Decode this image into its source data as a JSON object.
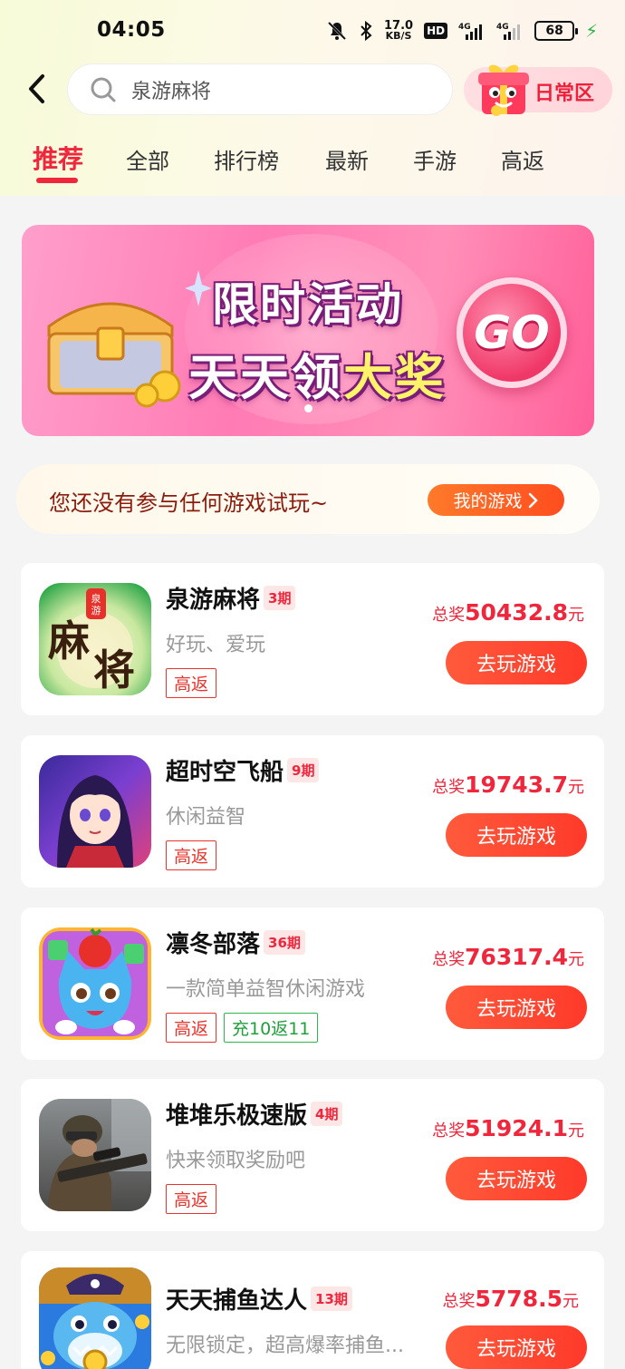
{
  "status_bar": {
    "time": "04:05",
    "net_speed_value": "17.0",
    "net_speed_unit": "KB/S",
    "hd_label": "HD",
    "signal1_label": "4G",
    "signal2_label": "4G",
    "battery": "68"
  },
  "header": {
    "search_value": "泉游麻将",
    "daily_zone_label": "日常区"
  },
  "tabs": [
    "推荐",
    "全部",
    "排行榜",
    "最新",
    "手游",
    "高返"
  ],
  "banner": {
    "line1": "限时活动",
    "line2_main": "天天领",
    "line2_highlight": "大奖",
    "go_label": "GO"
  },
  "notice": {
    "text": "您还没有参与任何游戏试玩~",
    "button_label": "我的游戏"
  },
  "games": [
    {
      "name": "泉游麻将",
      "period": "3期",
      "desc": "好玩、爱玩",
      "tags": [
        "高返"
      ],
      "prize_label": "总奖",
      "prize_value": "50432.8",
      "prize_unit": "元",
      "button": "去玩游戏",
      "icon_text_top": "泉游",
      "icon_text_main": "麻将"
    },
    {
      "name": "超时空飞船",
      "period": "9期",
      "desc": "休闲益智",
      "tags": [
        "高返"
      ],
      "prize_label": "总奖",
      "prize_value": "19743.7",
      "prize_unit": "元",
      "button": "去玩游戏"
    },
    {
      "name": "凛冬部落",
      "period": "36期",
      "desc": "一款简单益智休闲游戏",
      "tags": [
        "高返",
        "充10返11"
      ],
      "prize_label": "总奖",
      "prize_value": "76317.4",
      "prize_unit": "元",
      "button": "去玩游戏"
    },
    {
      "name": "堆堆乐极速版",
      "period": "4期",
      "desc": "快来领取奖励吧",
      "tags": [
        "高返"
      ],
      "prize_label": "总奖",
      "prize_value": "51924.1",
      "prize_unit": "元",
      "button": "去玩游戏"
    },
    {
      "name": "天天捕鱼达人",
      "period": "13期",
      "desc": "无限锁定，超高爆率捕鱼...",
      "tags": [],
      "prize_label": "总奖",
      "prize_value": "5778.5",
      "prize_unit": "元",
      "button": "去玩游戏"
    }
  ],
  "colors": {
    "accent": "#f0263c",
    "button": "#ff4a30",
    "tag_red": "#e8352c",
    "tag_green": "#2db84b"
  }
}
